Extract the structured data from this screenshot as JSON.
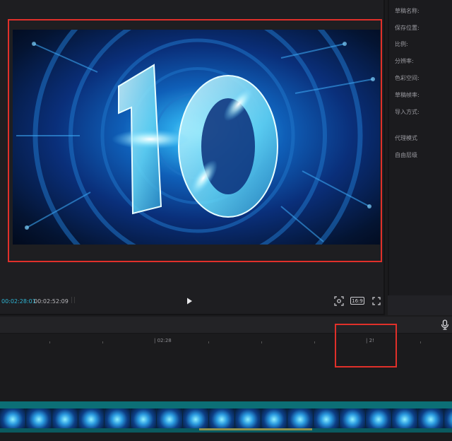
{
  "player": {
    "timecode_current": "00:02:28:01",
    "timecode_total": "00:02:52:09",
    "grip_glyph": "||",
    "play_icon": "play-icon",
    "screenshot_icon": "screenshot-icon",
    "aspect_ratio": "16:9",
    "fullscreen_icon": "fullscreen-icon",
    "frame_text": "10"
  },
  "side_panel": {
    "properties": [
      "草稿名称:",
      "保存位置:",
      "比例:",
      "分辨率:",
      "色彩空间:",
      "草稿帧率:",
      "导入方式:",
      "代理模式",
      "自由层级"
    ]
  },
  "timeline": {
    "mic_icon": "microphone-icon",
    "ruler_labels": [
      "| 02:28",
      "| 2!"
    ]
  },
  "colors": {
    "highlight": "#e0302a",
    "timecode": "#2fb7d6",
    "track": "#0c6f76"
  }
}
